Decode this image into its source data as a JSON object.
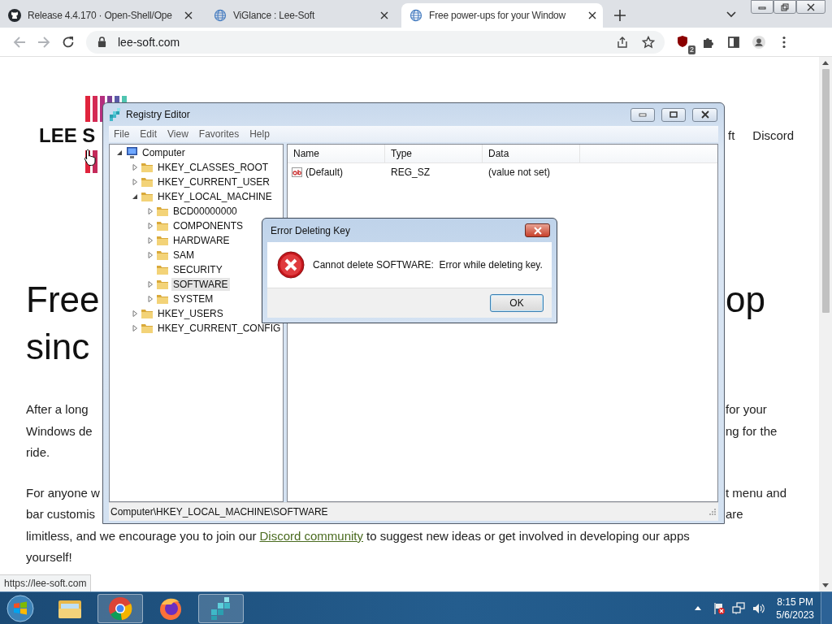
{
  "browser": {
    "tabs": [
      {
        "title": "Release 4.4.170 · Open-Shell/Ope",
        "selected": false
      },
      {
        "title": "ViGlance : Lee-Soft",
        "selected": false
      },
      {
        "title": "Free power-ups for your Window",
        "selected": true
      }
    ],
    "address": "lee-soft.com",
    "extension_badge": "2"
  },
  "page": {
    "logo_text": "LEE S",
    "nav": [
      "ft",
      "Discord"
    ],
    "heading": [
      {
        "left": "Free",
        "right": "op"
      },
      {
        "left": "sinc"
      }
    ],
    "paragraphs": [
      {
        "lines": [
          {
            "left": "After a long",
            "right": "for your"
          },
          {
            "left": "Windows de",
            "right": "ng for the"
          },
          {
            "left": "ride."
          }
        ]
      },
      {
        "lines": [
          {
            "left": "For anyone w",
            "right": "t menu and"
          },
          {
            "left": "bar customis",
            "right": "are"
          },
          {
            "before": "limitless, and we encourage you to join our",
            "link": "Discord community",
            "after": "to suggest new ideas or get involved in developing our apps"
          },
          {
            "left": "yourself!"
          }
        ]
      }
    ],
    "status_url": "https://lee-soft.com"
  },
  "regedit": {
    "title": "Registry Editor",
    "menu": [
      "File",
      "Edit",
      "View",
      "Favorites",
      "Help"
    ],
    "tree": [
      {
        "label": "Computer",
        "expandable": true,
        "expanded": true,
        "selected": false,
        "children": [
          {
            "label": "HKEY_CLASSES_ROOT",
            "expandable": true,
            "expanded": false,
            "selected": false
          },
          {
            "label": "HKEY_CURRENT_USER",
            "expandable": true,
            "expanded": false,
            "selected": false
          },
          {
            "label": "HKEY_LOCAL_MACHINE",
            "expandable": true,
            "expanded": true,
            "selected": false,
            "children": [
              {
                "label": "BCD00000000",
                "expandable": true,
                "expanded": false,
                "selected": false
              },
              {
                "label": "COMPONENTS",
                "expandable": true,
                "expanded": false,
                "selected": false
              },
              {
                "label": "HARDWARE",
                "expandable": true,
                "expanded": false,
                "selected": false
              },
              {
                "label": "SAM",
                "expandable": true,
                "expanded": false,
                "selected": false
              },
              {
                "label": "SECURITY",
                "expandable": false,
                "expanded": false,
                "selected": false
              },
              {
                "label": "SOFTWARE",
                "expandable": true,
                "expanded": false,
                "selected": true
              },
              {
                "label": "SYSTEM",
                "expandable": true,
                "expanded": false,
                "selected": false
              }
            ]
          },
          {
            "label": "HKEY_USERS",
            "expandable": true,
            "expanded": false,
            "selected": false
          },
          {
            "label": "HKEY_CURRENT_CONFIG",
            "expandable": true,
            "expanded": false,
            "selected": false
          }
        ]
      }
    ],
    "columns": [
      "Name",
      "Type",
      "Data"
    ],
    "rows": [
      {
        "name": "(Default)",
        "type": "REG_SZ",
        "data": "(value not set)"
      }
    ],
    "status": "Computer\\HKEY_LOCAL_MACHINE\\SOFTWARE"
  },
  "dialog": {
    "title": "Error Deleting Key",
    "message": "Cannot delete SOFTWARE:  Error while deleting key.",
    "button": "OK"
  },
  "taskbar": {
    "apps": [
      {
        "kind": "explorer",
        "running": false
      },
      {
        "kind": "chrome",
        "running": true
      },
      {
        "kind": "firefox",
        "running": false
      },
      {
        "kind": "regedit",
        "running": true
      }
    ],
    "time": "8:15 PM",
    "date": "5/6/2023"
  }
}
